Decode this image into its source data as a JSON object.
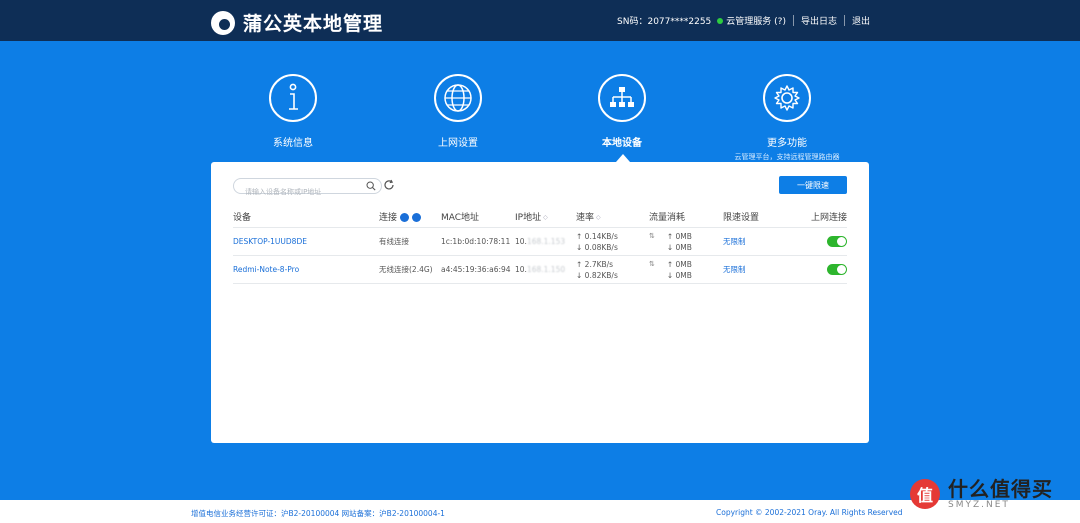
{
  "header": {
    "title": "蒲公英本地管理",
    "sn": "SN码：2077****2255",
    "cloud_service": "云管理服务 (?)",
    "export_log": "导出日志",
    "logout": "退出"
  },
  "nav": {
    "items": [
      {
        "label": "系统信息",
        "icon": "info-icon"
      },
      {
        "label": "上网设置",
        "icon": "globe-icon"
      },
      {
        "label": "本地设备",
        "icon": "network-tree-icon",
        "active": true
      },
      {
        "label": "更多功能",
        "sub": "云管理平台，支持远程管理路由器",
        "icon": "gear-icon"
      }
    ]
  },
  "toolbar": {
    "search_placeholder": "请输入设备名称或IP地址",
    "limit_button": "一键限速"
  },
  "table": {
    "headers": [
      "设备",
      "连接",
      "MAC地址",
      "IP地址",
      "速率",
      "流量消耗",
      "限速设置",
      "上网连接"
    ],
    "rows": [
      {
        "device": "DESKTOP-1UUD8DE",
        "connection": "有线连接",
        "mac": "1c:1b:0d:10:78:11",
        "ip": "10.",
        "ip_masked": "168.1.153",
        "rate_up": "↑ 0.14KB/s",
        "rate_down": "↓ 0.08KB/s",
        "traffic_up": "↑ 0MB",
        "traffic_down": "↓ 0MB",
        "limit": "无限制",
        "online": true
      },
      {
        "device": "Redmi-Note-8-Pro",
        "connection": "无线连接(2.4G)",
        "mac": "a4:45:19:36:a6:94",
        "ip": "10.",
        "ip_masked": "168.1.150",
        "rate_up": "↑ 2.7KB/s",
        "rate_down": "↓ 0.82KB/s",
        "traffic_up": "↑ 0MB",
        "traffic_down": "↓ 0MB",
        "limit": "无限制",
        "online": true
      }
    ]
  },
  "footer": {
    "left": "增值电信业务经营许可证：沪B2-20100004  网站备案：沪B2-20100004-1",
    "right": "Copyright © 2002-2021 Oray. All Rights Reserved"
  },
  "watermark": {
    "seal": "值",
    "name": "什么值得买",
    "domain": "SMYZ.NET"
  },
  "colors": {
    "background": "#0d7ee6",
    "header": "#0e2e56",
    "accent": "#1a6fd8",
    "toggle_on": "#2db52d"
  }
}
